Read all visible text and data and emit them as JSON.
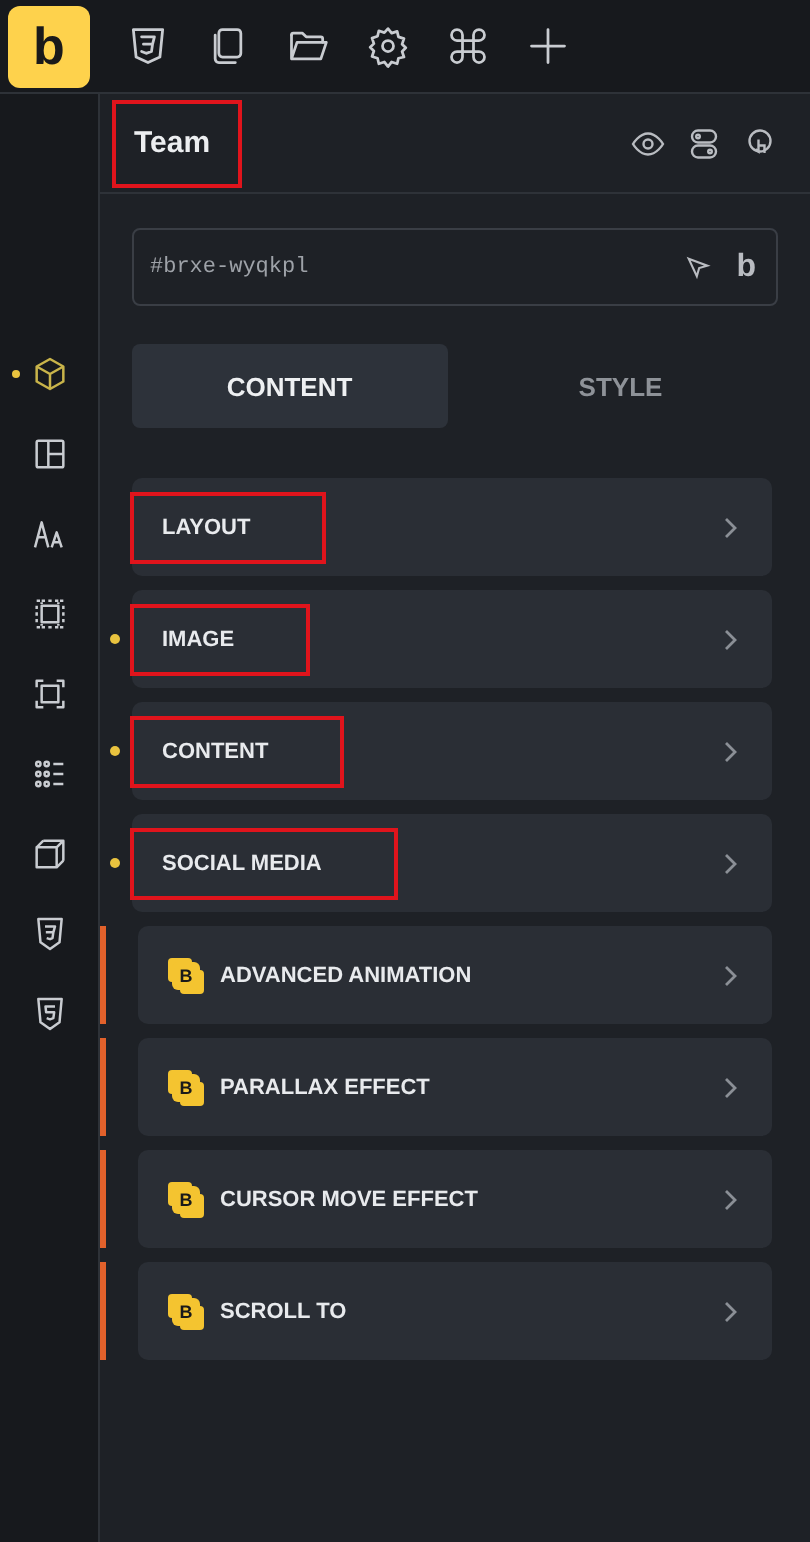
{
  "logo": "b",
  "toolbar": [
    {
      "kind": "css"
    },
    {
      "kind": "pages"
    },
    {
      "kind": "folder"
    },
    {
      "kind": "settings"
    },
    {
      "kind": "command"
    },
    {
      "kind": "add"
    }
  ],
  "rail": [
    {
      "kind": "cube",
      "selected": true
    },
    {
      "kind": "layout",
      "selected": false
    },
    {
      "kind": "typography",
      "selected": false
    },
    {
      "kind": "frame",
      "selected": false
    },
    {
      "kind": "square",
      "selected": false
    },
    {
      "kind": "grid",
      "selected": false
    },
    {
      "kind": "box3d",
      "selected": false
    },
    {
      "kind": "css",
      "selected": false
    },
    {
      "kind": "html",
      "selected": false
    }
  ],
  "panel": {
    "title": "Team",
    "title_highlighted": true,
    "element_id": "#brxe-wyqkpl",
    "brand": "b",
    "tabs": [
      {
        "label": "CONTENT",
        "selected": true
      },
      {
        "label": "STYLE",
        "selected": false
      }
    ],
    "sections": [
      {
        "label": "LAYOUT",
        "modified": false,
        "highlighted": true
      },
      {
        "label": "IMAGE",
        "modified": true,
        "highlighted": true
      },
      {
        "label": "CONTENT",
        "modified": true,
        "highlighted": true
      },
      {
        "label": "SOCIAL MEDIA",
        "modified": true,
        "highlighted": true
      }
    ],
    "addons": [
      {
        "label": "ADVANCED ANIMATION",
        "badge": "B"
      },
      {
        "label": "PARALLAX EFFECT",
        "badge": "B"
      },
      {
        "label": "CURSOR MOVE EFFECT",
        "badge": "B"
      },
      {
        "label": "SCROLL TO",
        "badge": "B"
      }
    ]
  }
}
